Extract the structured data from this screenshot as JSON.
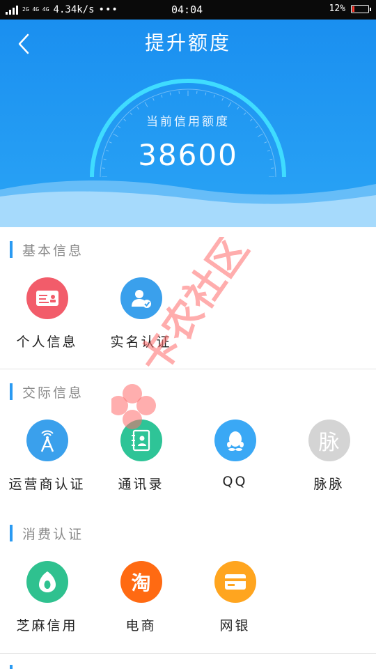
{
  "status_bar": {
    "network": "2G 4G 4G",
    "speed": "4.34k/s",
    "dots": "•••",
    "time": "04:04",
    "battery": "12%",
    "battery_level": 0.12,
    "battery_color": "#ff3b30"
  },
  "header": {
    "title": "提升额度",
    "credit_label": "当前信用额度",
    "credit_value": "38600",
    "background": "#1a8ff0",
    "gauge_color": "#3fdcff"
  },
  "sections": [
    {
      "title": "基本信息",
      "items": [
        {
          "label": "个人信息",
          "icon": "id-card-icon",
          "color": "#f25c6a"
        },
        {
          "label": "实名认证",
          "icon": "verified-user-icon",
          "color": "#3aa0ec"
        }
      ]
    },
    {
      "title": "交际信息",
      "items": [
        {
          "label": "运营商认证",
          "icon": "signal-tower-icon",
          "color": "#3aa0ec"
        },
        {
          "label": "通讯录",
          "icon": "contacts-book-icon",
          "color": "#2ec497"
        },
        {
          "label": "QQ",
          "icon": "qq-penguin-icon",
          "color": "#3aa8f5"
        },
        {
          "label": "脉脉",
          "icon": "maimai-icon",
          "glyph": "脉",
          "color": "#d4d4d4"
        }
      ]
    },
    {
      "title": "消费认证",
      "items": [
        {
          "label": "芝麻信用",
          "icon": "sesame-credit-icon",
          "color": "#2fc18f"
        },
        {
          "label": "电商",
          "icon": "taobao-icon",
          "glyph": "淘",
          "color": "#ff6a12"
        },
        {
          "label": "网银",
          "icon": "bank-card-icon",
          "color": "#ffa51f"
        }
      ]
    }
  ],
  "watermark": {
    "text": "卡农社区",
    "color": "#ff6b6b"
  }
}
